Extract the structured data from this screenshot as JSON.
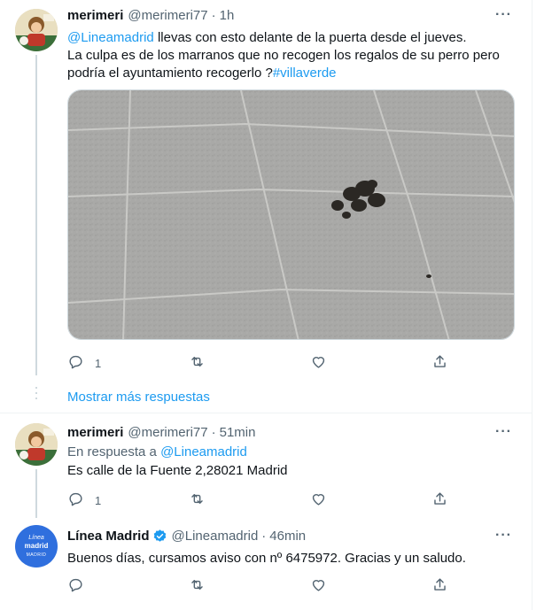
{
  "tweets": [
    {
      "name": "merimeri",
      "handle": "@merimeri77",
      "sep": "·",
      "time": "1h",
      "more": "···",
      "mention": "@Lineamadrid",
      "text_1": " llevas con esto delante de la puerta desde el jueves.",
      "text_2": "La culpa es de los marranos que no recogen los regalos de su perro pero podría el ayuntamiento recogerlo ?",
      "hashtag": "#villaverde",
      "reply_count": "1"
    },
    {
      "name": "merimeri",
      "handle": "@merimeri77",
      "sep": "·",
      "time": "51min",
      "more": "···",
      "reply_prefix": "En respuesta a ",
      "reply_to": "@Lineamadrid",
      "text": "Es calle de la Fuente 2,28021 Madrid",
      "reply_count": "1"
    },
    {
      "name": "Línea Madrid",
      "handle": "@Lineamadrid",
      "sep": "·",
      "time": "46min",
      "more": "···",
      "text": "Buenos días, cursamos aviso con nº 6475972. Gracias y un saludo.",
      "avatar_line1": "Línea",
      "avatar_line2": "madrid",
      "avatar_line3": "MADRID"
    }
  ],
  "show_more": "Mostrar más respuestas",
  "icons": [
    "reply-icon",
    "retweet-icon",
    "like-icon",
    "share-icon",
    "verified-icon"
  ],
  "colors": {
    "link": "#1d9bf0",
    "muted": "#536471",
    "verified": "#1d9bf0",
    "linea_madrid_blue": "#2f6fde"
  }
}
